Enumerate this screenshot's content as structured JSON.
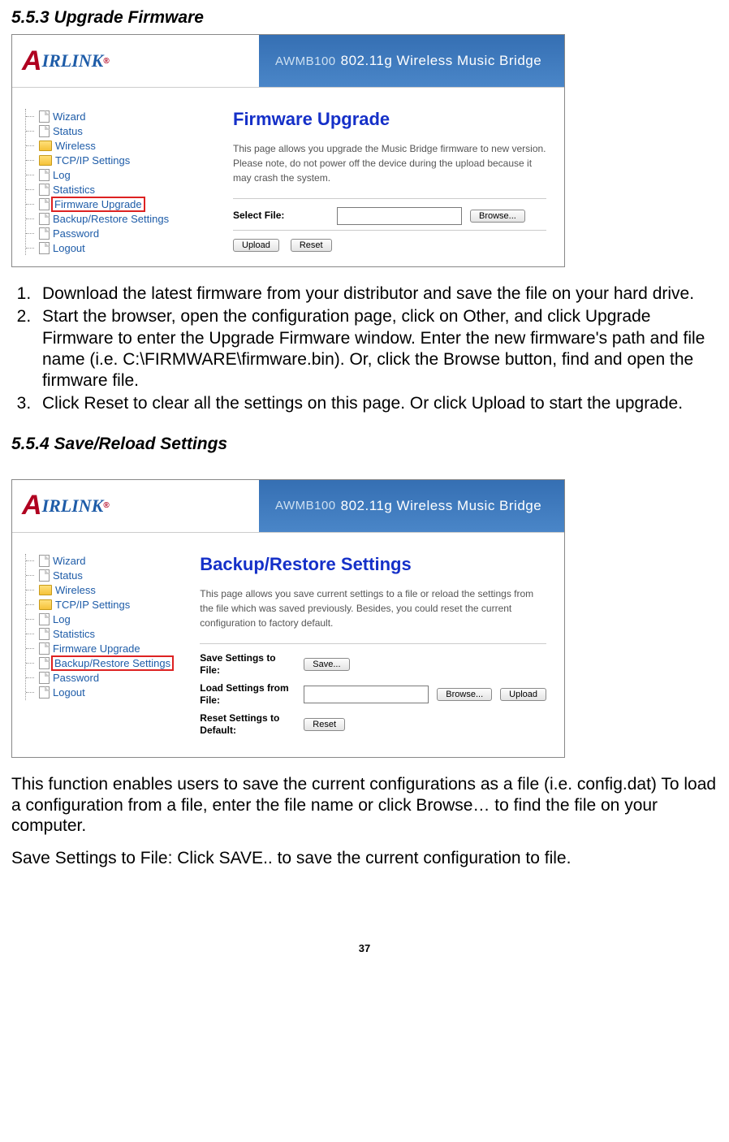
{
  "section1": {
    "heading": "5.5.3 Upgrade Firmware",
    "banner_model": "AWMB100",
    "banner_text": "802.11g Wireless Music Bridge",
    "logo_text": "IRLINK",
    "nav": [
      {
        "label": "Wizard",
        "type": "file"
      },
      {
        "label": "Status",
        "type": "file"
      },
      {
        "label": "Wireless",
        "type": "folder"
      },
      {
        "label": "TCP/IP Settings",
        "type": "folder"
      },
      {
        "label": "Log",
        "type": "file"
      },
      {
        "label": "Statistics",
        "type": "file"
      },
      {
        "label": "Firmware Upgrade",
        "type": "file",
        "highlight": true
      },
      {
        "label": "Backup/Restore Settings",
        "type": "file"
      },
      {
        "label": "Password",
        "type": "file"
      },
      {
        "label": "Logout",
        "type": "file"
      }
    ],
    "page_title": "Firmware Upgrade",
    "page_desc": "This page allows you upgrade the Music Bridge firmware to new version. Please note, do not power off the device during the upload because it may crash the system.",
    "select_file_label": "Select File:",
    "browse_btn": "Browse...",
    "upload_btn": "Upload",
    "reset_btn": "Reset"
  },
  "instructions1": [
    "Download the latest firmware from your distributor and save the file on your hard drive.",
    "Start the browser, open the configuration page, click on Other, and click Upgrade Firmware to enter the Upgrade Firmware window. Enter the new firmware's path and file name (i.e. C:\\FIRMWARE\\firmware.bin). Or, click the Browse button, find and open the firmware file.",
    "Click Reset to clear all the settings on this page. Or click Upload to start the upgrade."
  ],
  "section2": {
    "heading": "5.5.4 Save/Reload Settings",
    "nav": [
      {
        "label": "Wizard",
        "type": "file"
      },
      {
        "label": "Status",
        "type": "file"
      },
      {
        "label": "Wireless",
        "type": "folder"
      },
      {
        "label": "TCP/IP Settings",
        "type": "folder"
      },
      {
        "label": "Log",
        "type": "file"
      },
      {
        "label": "Statistics",
        "type": "file"
      },
      {
        "label": "Firmware Upgrade",
        "type": "file"
      },
      {
        "label": "Backup/Restore Settings",
        "type": "file",
        "highlight": true
      },
      {
        "label": "Password",
        "type": "file"
      },
      {
        "label": "Logout",
        "type": "file"
      }
    ],
    "page_title": "Backup/Restore Settings",
    "page_desc": "This page allows you save current settings to a file or reload the settings from the file which was saved previously. Besides, you could reset the current configuration to factory default.",
    "save_label": "Save Settings to File:",
    "save_btn": "Save...",
    "load_label": "Load Settings from File:",
    "browse_btn": "Browse...",
    "upload_btn": "Upload",
    "reset_label": "Reset Settings to Default:",
    "reset_btn": "Reset"
  },
  "para1": "This function enables users to save the current configurations as a file (i.e. config.dat) To load a configuration from a file, enter the file name or click Browse… to find the file on your computer.",
  "para2": "Save Settings to File: Click SAVE..  to save the current configuration to file.",
  "page_number": "37"
}
